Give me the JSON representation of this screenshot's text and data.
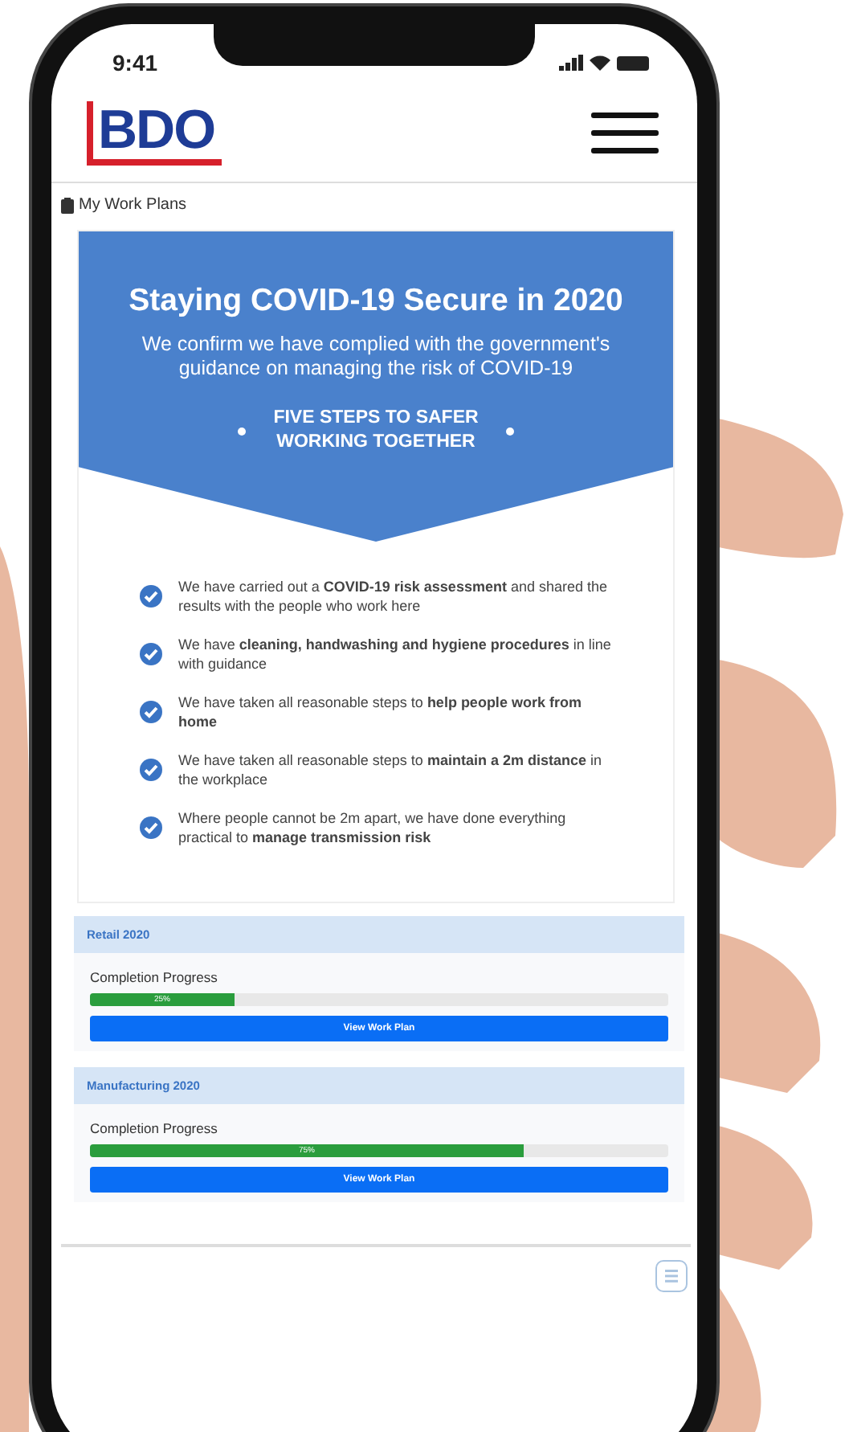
{
  "status_bar": {
    "time": "9:41"
  },
  "header": {
    "logo": "BDO"
  },
  "page_title": "My Work Plans",
  "banner": {
    "title": "Staying COVID-19 Secure in 2020",
    "subtitle": "We confirm we have complied with the government's guidance on managing the risk of COVID-19",
    "steps_heading": "FIVE STEPS TO SAFER WORKING TOGETHER"
  },
  "checklist": [
    {
      "text": "We have carried out a **COVID-19 risk assessment** and shared the results with the people who work here",
      "checked": true
    },
    {
      "text": "We have **cleaning, handwashing and hygiene procedures** in line with guidance",
      "checked": true
    },
    {
      "text": "We have taken all reasonable steps to **help people work from home**",
      "checked": true
    },
    {
      "text": "We have taken all reasonable steps to **maintain a 2m distance** in the workplace",
      "checked": true
    },
    {
      "text": "Where people cannot be 2m apart, we have done everything practical to **manage transmission risk**",
      "checked": true
    }
  ],
  "work_plans": [
    {
      "name": "Retail 2020",
      "progress_label": "Completion Progress",
      "level": 0.25,
      "reading": "25%",
      "button": "View Work Plan"
    },
    {
      "name": "Manufacturing 2020",
      "progress_label": "Completion Progress",
      "level": 0.75,
      "reading": "75%",
      "button": "View Work Plan"
    }
  ]
}
